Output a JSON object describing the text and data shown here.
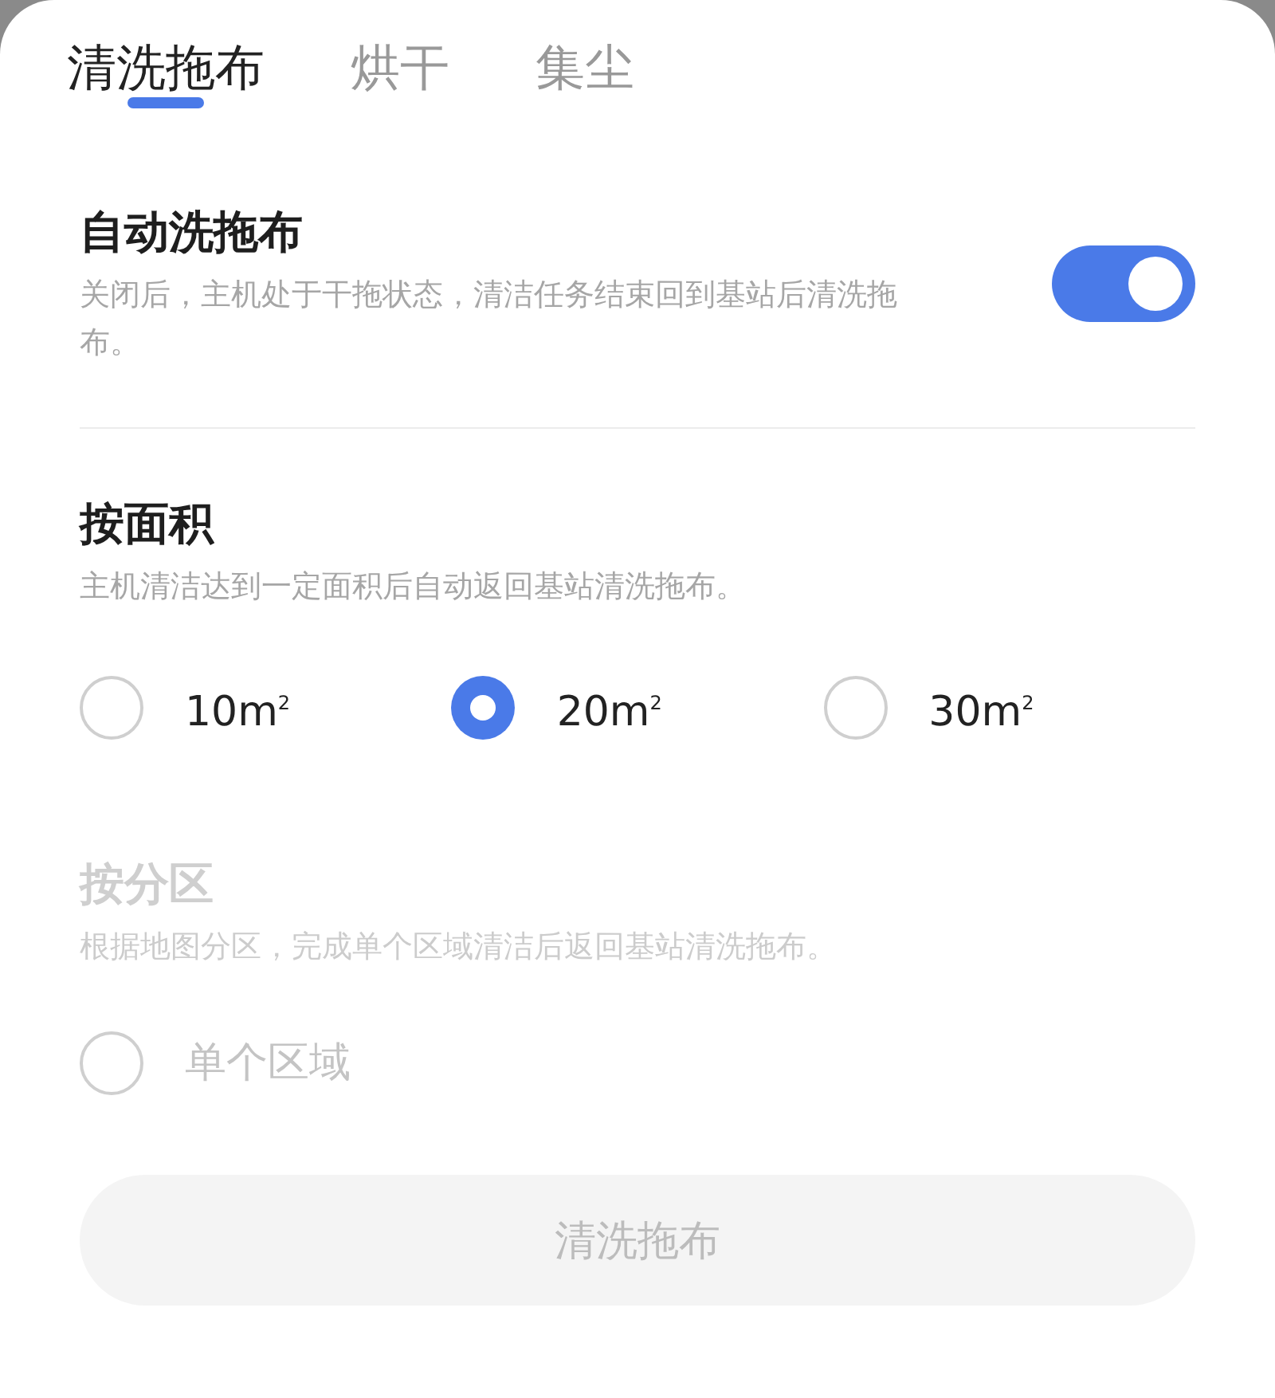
{
  "tabs": [
    {
      "label": "清洗拖布",
      "selected": true
    },
    {
      "label": "烘干",
      "selected": false
    },
    {
      "label": "集尘",
      "selected": false
    }
  ],
  "sections": [
    {
      "kind": "toggle",
      "title": "自动洗拖布",
      "description": "关闭后，主机处于干拖状态，清洁任务结束回到基站后清洗拖布。",
      "on": true,
      "disabled": false
    },
    {
      "kind": "radio",
      "title": "按面积",
      "description": "主机清洁达到一定面积后自动返回基站清洗拖布。",
      "disabled": false,
      "options": [
        {
          "label": "10m$^{2}$",
          "selected": false
        },
        {
          "label": "20m$^{2}$",
          "selected": true
        },
        {
          "label": "30m$^{2}$",
          "selected": false
        }
      ]
    },
    {
      "kind": "radio",
      "title": "按分区",
      "description": "根据地图分区，完成单个区域清洁后返回基站清洗拖布。",
      "disabled": true,
      "options": [
        {
          "label": "单个区域",
          "selected": false
        }
      ]
    }
  ],
  "action_button": {
    "label": "清洗拖布",
    "disabled": true
  }
}
